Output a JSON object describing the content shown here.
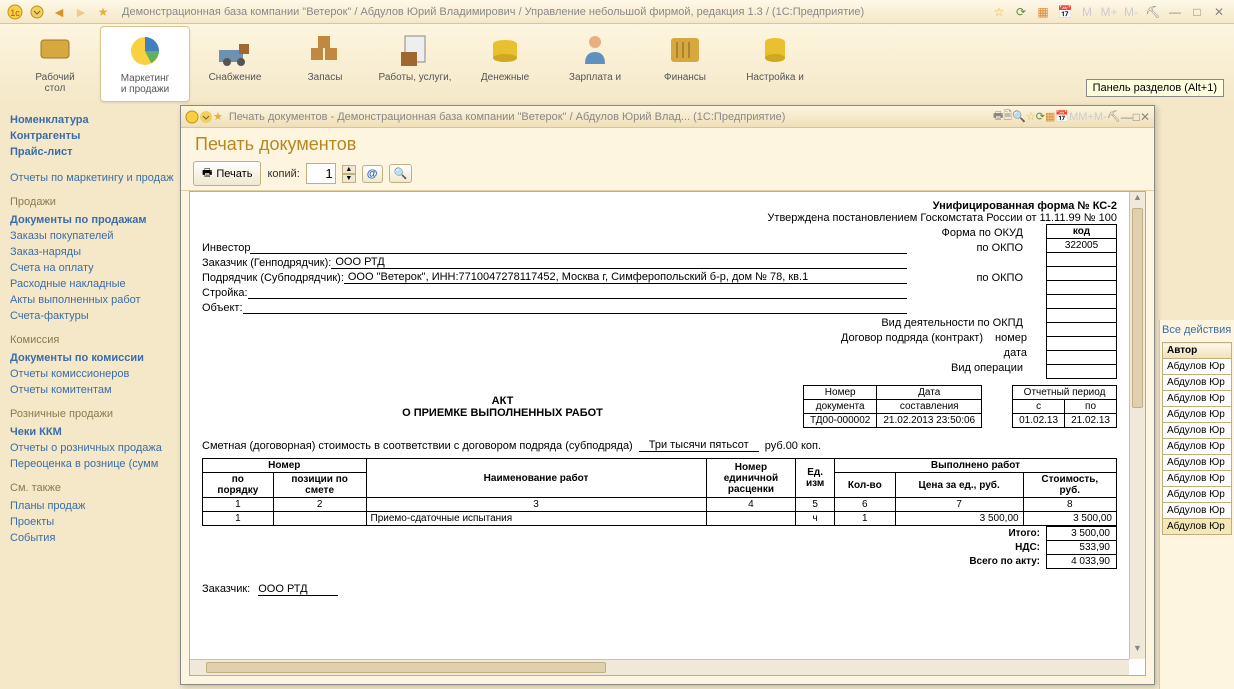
{
  "main_title": "Демонстрационная база компании \"Ветерок\" / Абдулов Юрий Владимирович / Управление небольшой фирмой, редакция 1.3 /  (1С:Предприятие)",
  "sections": [
    {
      "label": "Рабочий\nстол"
    },
    {
      "label": "Маркетинг\nи продажи"
    },
    {
      "label": "Снабжение"
    },
    {
      "label": "Запасы"
    },
    {
      "label": "Работы, услуги,"
    },
    {
      "label": "Денежные"
    },
    {
      "label": "Зарплата и"
    },
    {
      "label": "Финансы"
    },
    {
      "label": "Настройка и"
    }
  ],
  "section_hint": "Панель разделов (Alt+1)",
  "nav": {
    "g1_items": [
      "Номенклатура",
      "Контрагенты",
      "Прайс-лист"
    ],
    "reports1": "Отчеты по маркетингу и продаж",
    "g2_title": "Продажи",
    "g2_items": [
      "Документы по продажам",
      "Заказы покупателей",
      "Заказ-наряды",
      "Счета на оплату",
      "Расходные накладные",
      "Акты выполненных работ",
      "Счета-фактуры"
    ],
    "g3_title": "Комиссия",
    "g3_items": [
      "Документы по комиссии",
      "Отчеты комиссионеров",
      "Отчеты комитентам"
    ],
    "g4_title": "Розничные продажи",
    "g4_items": [
      "Чеки ККМ",
      "Отчеты о розничных продажа",
      "Переоценка в рознице (сумм"
    ],
    "g5_title": "См. также",
    "g5_items": [
      "Планы продаж",
      "Проекты",
      "События"
    ]
  },
  "subwindow": {
    "title": "Печать документов - Демонстрационная база компании \"Ветерок\" / Абдулов Юрий Влад...  (1С:Предприятие)",
    "header": "Печать документов",
    "toolbar": {
      "print": "Печать",
      "copies_label": "копий:",
      "copies": "1"
    }
  },
  "doc": {
    "form_title": "Унифицированная форма № КС-2",
    "approved": "Утверждена постановлением Госкомстата России от 11.11.99 № 100",
    "codes": {
      "kod_h": "код",
      "okud_label": "Форма по ОКУД",
      "okud": "322005"
    },
    "investor_l": "Инвестор",
    "investor_v": "",
    "zakazchik_l": "Заказчик (Генподрядчик):",
    "zakazchik_v": "ООО РТД",
    "podryadchik_l": "Подрядчик (Субподрядчик):",
    "podryadchik_v": "ООО \"Ветерок\", ИНН:7710047278117452, Москва г, Симферопольский б-р, дом № 78, кв.1",
    "stroyka_l": "Стройка:",
    "stroyka_v": "",
    "object_l": "Объект:",
    "object_v": "",
    "okpo_l": "по ОКПО",
    "okpd_l": "Вид деятельности по ОКПД",
    "contract_l": "Договор подряда (контракт)",
    "nomer_l": "номер",
    "data_l": "дата",
    "vidop_l": "Вид операции",
    "docnum_h1": "Номер",
    "docnum_h2": "документа",
    "docdate_h1": "Дата",
    "docdate_h2": "составления",
    "docnum": "ТД00-000002",
    "docdate": "21.02.2013 23:50:06",
    "period_h": "Отчетный период",
    "period_s": "с",
    "period_po": "по",
    "period_from": "01.02.13",
    "period_to": "21.02.13",
    "act_title_1": "АКТ",
    "act_title_2": "О ПРИЕМКЕ ВЫПОЛНЕННЫХ РАБОТ",
    "cost_text": "Сметная (договорная) стоимость в соответствии с договором подряда (субподряда)",
    "cost_val": "Три тысячи пятьсот",
    "cost_unit": "руб.00 коп.",
    "works_headers": {
      "nomer": "Номер",
      "pp": "по\nпорядку",
      "pos": "позиции по\nсмете",
      "name": "Наименование работ",
      "ednom": "Номер\nединичной\nрасценки",
      "edizm": "Ед.\nизм",
      "vyp": "Выполнено работ",
      "kolvo": "Кол-во",
      "cena": "Цена за ед., руб.",
      "stoim": "Стоимость,\nруб."
    },
    "works_idx": {
      "c1": "1",
      "c2": "2",
      "c3": "3",
      "c4": "4",
      "c5": "5",
      "c6": "6",
      "c7": "7",
      "c8": "8"
    },
    "works_row": {
      "n": "1",
      "pos": "",
      "name": "Приемо-сдаточные испытания",
      "ednom": "",
      "ed": "ч",
      "kol": "1",
      "cena": "3 500,00",
      "stoim": "3 500,00"
    },
    "totals": {
      "itogo_l": "Итого:",
      "itogo": "3 500,00",
      "nds_l": "НДС:",
      "nds": "533,90",
      "all_l": "Всего по акту:",
      "all": "4 033,90"
    },
    "footer_zakazchik": "Заказчик:",
    "footer_zv": "ООО РТД"
  },
  "right_panel": {
    "actions": "Все действия",
    "col": "Автор",
    "rows": [
      "Абдулов Юр",
      "Абдулов Юр",
      "Абдулов Юр",
      "Абдулов Юр",
      "Абдулов Юр",
      "Абдулов Юр",
      "Абдулов Юр",
      "Абдулов Юр",
      "Абдулов Юр",
      "Абдулов Юр",
      "Абдулов Юр"
    ]
  }
}
